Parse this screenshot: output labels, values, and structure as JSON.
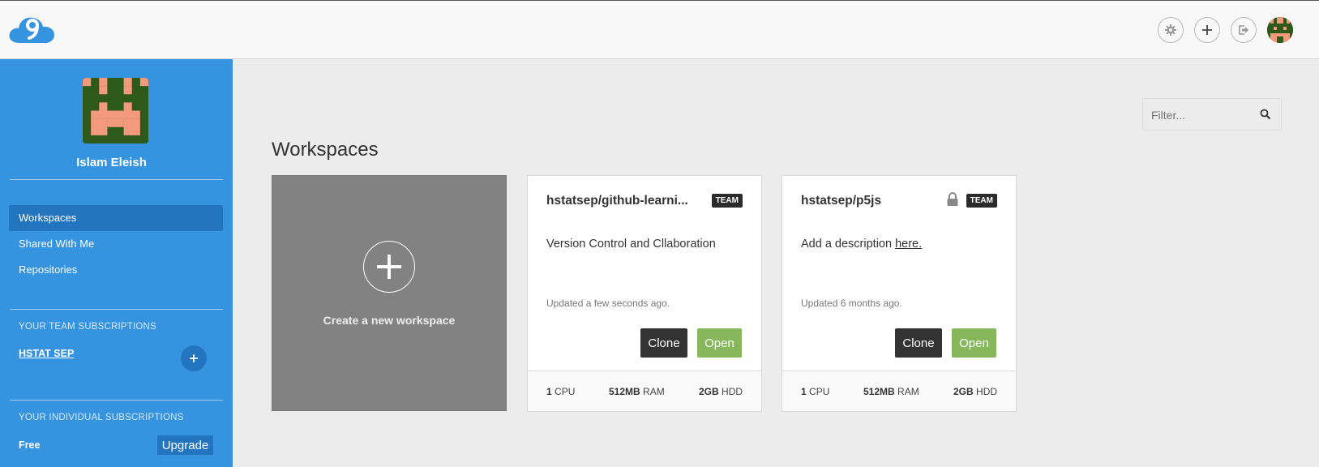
{
  "header": {
    "logo_icon": "cloud9-logo-icon",
    "icons": [
      "gear-icon",
      "plus-icon",
      "sign-out-icon",
      "user-avatar"
    ]
  },
  "sidebar": {
    "user_name": "Islam Eleish",
    "nav": [
      {
        "label": "Workspaces",
        "active": true
      },
      {
        "label": "Shared With Me",
        "active": false
      },
      {
        "label": "Repositories",
        "active": false
      }
    ],
    "team_section_title": "YOUR TEAM SUBSCRIPTIONS",
    "team_name": "HSTAT SEP",
    "individual_section_title": "YOUR INDIVIDUAL SUBSCRIPTIONS",
    "plan": "Free",
    "upgrade_label": "Upgrade"
  },
  "main": {
    "filter_placeholder": "Filter...",
    "title": "Workspaces",
    "create_label": "Create a new workspace",
    "workspaces": [
      {
        "name": "hstatsep/github-learni...",
        "badge": "TEAM",
        "locked": false,
        "description": "Version Control and Cllaboration",
        "updated": "Updated a few seconds ago.",
        "clone_label": "Clone",
        "open_label": "Open",
        "cpu_value": "1",
        "cpu_unit": "CPU",
        "ram_value": "512MB",
        "ram_unit": "RAM",
        "hdd_value": "2GB",
        "hdd_unit": "HDD"
      },
      {
        "name": "hstatsep/p5js",
        "badge": "TEAM",
        "locked": true,
        "description_prefix": "Add a description ",
        "description_link": "here.",
        "updated": "Updated 6 months ago.",
        "clone_label": "Clone",
        "open_label": "Open",
        "cpu_value": "1",
        "cpu_unit": "CPU",
        "ram_value": "512MB",
        "ram_unit": "RAM",
        "hdd_value": "2GB",
        "hdd_unit": "HDD"
      }
    ]
  },
  "colors": {
    "sidebar": "#3593e0",
    "sidebar_active": "#2375bf",
    "open_button": "#86b85b",
    "clone_button": "#333333",
    "avatar_dark": "#2d5a1b",
    "avatar_light": "#f49a7c"
  }
}
